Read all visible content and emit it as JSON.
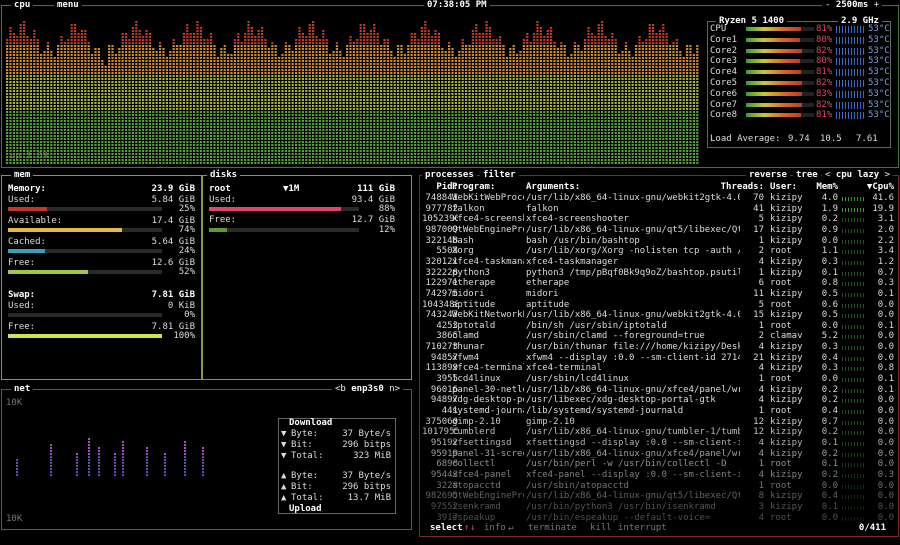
{
  "header": {
    "cpu_tab": "cpu",
    "menu_tab": "menu",
    "clock": "07:38:05 PM",
    "interval": "2500ms",
    "minus": "-",
    "plus": "+"
  },
  "cpu": {
    "model": "Ryzen 5 1400",
    "freq": "2.9 GHz",
    "uptime": "up 1:09",
    "cores": [
      {
        "name": "CPU",
        "pct": "81%",
        "pct_val": 81,
        "temp": "53°C"
      },
      {
        "name": "Core1",
        "pct": "80%",
        "pct_val": 80,
        "temp": "53°C"
      },
      {
        "name": "Core2",
        "pct": "82%",
        "pct_val": 82,
        "temp": "53°C"
      },
      {
        "name": "Core3",
        "pct": "80%",
        "pct_val": 80,
        "temp": "53°C"
      },
      {
        "name": "Core4",
        "pct": "81%",
        "pct_val": 81,
        "temp": "53°C"
      },
      {
        "name": "Core5",
        "pct": "82%",
        "pct_val": 82,
        "temp": "53°C"
      },
      {
        "name": "Core6",
        "pct": "83%",
        "pct_val": 83,
        "temp": "53°C"
      },
      {
        "name": "Core7",
        "pct": "82%",
        "pct_val": 82,
        "temp": "53°C"
      },
      {
        "name": "Core8",
        "pct": "81%",
        "pct_val": 81,
        "temp": "53°C"
      }
    ],
    "load_label": "Load Average:",
    "load": [
      "9.74",
      "10.5",
      "7.61"
    ]
  },
  "mem": {
    "tab": "mem",
    "memory_label": "Memory:",
    "memory_total": "23.9 GiB",
    "rows": [
      {
        "label": "Used:",
        "value": "5.84 GiB",
        "pct": "25%",
        "pct_val": 25,
        "color": "#c0392b"
      },
      {
        "label": "Available:",
        "value": "17.4 GiB",
        "pct": "74%",
        "pct_val": 74,
        "color": "#e5b94a"
      },
      {
        "label": "Cached:",
        "value": "5.64 GiB",
        "pct": "24%",
        "pct_val": 24,
        "color": "#3aa0b8"
      },
      {
        "label": "Free:",
        "value": "12.6 GiB",
        "pct": "52%",
        "pct_val": 52,
        "color": "#9bcc3a"
      }
    ],
    "swap_label": "Swap:",
    "swap_total": "7.81 GiB",
    "swap_rows": [
      {
        "label": "Used:",
        "value": "0 KiB",
        "pct": "0%",
        "pct_val": 0,
        "color": "#c0392b"
      },
      {
        "label": "Free:",
        "value": "7.81 GiB",
        "pct": "100%",
        "pct_val": 100,
        "color": "#c8e84a"
      }
    ]
  },
  "disks": {
    "tab": "disks",
    "root": "root",
    "io": "▼1M",
    "total": "111 GiB",
    "used_label": "Used:",
    "used": "93.4 GiB",
    "used_pct": "88%",
    "used_pct_val": 88,
    "used_color": "#e0456a",
    "free_label": "Free:",
    "free": "12.7 GiB",
    "free_pct": "12%",
    "free_pct_val": 12,
    "free_color": "#5a9a3a"
  },
  "net": {
    "tab": "net",
    "iface": "enp3s0",
    "prev": "<b",
    "next": "n>",
    "top_scale": "10K",
    "bottom_scale": "10K",
    "download_label": "Download",
    "upload_label": "Upload",
    "down": [
      {
        "arrow": "▼",
        "label": "Byte:",
        "value": "37 Byte/s"
      },
      {
        "arrow": "▼",
        "label": "Bit:",
        "value": "296 bitps"
      },
      {
        "arrow": "▼",
        "label": "Total:",
        "value": "323 MiB"
      }
    ],
    "up": [
      {
        "arrow": "▲",
        "label": "Byte:",
        "value": "37 Byte/s"
      },
      {
        "arrow": "▲",
        "label": "Bit:",
        "value": "296 bitps"
      },
      {
        "arrow": "▲",
        "label": "Total:",
        "value": "13.7 MiB"
      }
    ]
  },
  "proc": {
    "tabs": [
      "processes",
      "filter",
      "reverse",
      "tree",
      "cpu lazy"
    ],
    "lt": "<",
    "gt": ">",
    "headers": {
      "pid": "Pid:",
      "program": "Program:",
      "args": "Arguments:",
      "threads": "Threads:",
      "user": "User:",
      "mem": "Mem%",
      "cpu": "▼Cpu%"
    },
    "rows": [
      {
        "pid": "748841",
        "prog": "WebKitWebProce",
        "args": "/usr/lib/x86_64-linux-gnu/webkit2gtk-4.0/W",
        "thr": "70",
        "user": "kizipy",
        "mem": "4.0",
        "cpu": "41.6"
      },
      {
        "pid": "977782",
        "prog": "falkon",
        "args": "falkon",
        "thr": "41",
        "user": "kizipy",
        "mem": "1.9",
        "cpu": "19.9"
      },
      {
        "pid": "1052390",
        "prog": "xfce4-screensh",
        "args": "xfce4-screenshooter",
        "thr": "5",
        "user": "kizipy",
        "mem": "0.2",
        "cpu": "3.1"
      },
      {
        "pid": "987009",
        "prog": "QtWebEnginePro",
        "args": "/usr/lib/x86_64-linux-gnu/qt5/libexec/QtWe",
        "thr": "17",
        "user": "kizipy",
        "mem": "0.9",
        "cpu": "2.0"
      },
      {
        "pid": "322148",
        "prog": "bash",
        "args": "bash /usr/bin/bashtop",
        "thr": "1",
        "user": "kizipy",
        "mem": "0.0",
        "cpu": "2.2"
      },
      {
        "pid": "5508",
        "prog": "Xorg",
        "args": "/usr/lib/xorg/Xorg -nolisten tcp -auth /va",
        "thr": "2",
        "user": "root",
        "mem": "1.1",
        "cpu": "3.4"
      },
      {
        "pid": "320121",
        "prog": "xfce4-taskmana",
        "args": "xfce4-taskmanager",
        "thr": "4",
        "user": "kizipy",
        "mem": "0.3",
        "cpu": "1.2"
      },
      {
        "pid": "322228",
        "prog": "python3",
        "args": "python3 /tmp/pBqf0Bk9q9oZ/bashtop.psutil",
        "thr": "1",
        "user": "kizipy",
        "mem": "0.1",
        "cpu": "0.7"
      },
      {
        "pid": "122971",
        "prog": "etherape",
        "args": "etherape",
        "thr": "6",
        "user": "root",
        "mem": "0.8",
        "cpu": "0.3"
      },
      {
        "pid": "742975",
        "prog": "midori",
        "args": "midori",
        "thr": "11",
        "user": "kizipy",
        "mem": "0.5",
        "cpu": "0.1"
      },
      {
        "pid": "1043488",
        "prog": "aptitude",
        "args": "aptitude",
        "thr": "5",
        "user": "root",
        "mem": "0.6",
        "cpu": "0.0"
      },
      {
        "pid": "743247",
        "prog": "WebKitNetworkP",
        "args": "/usr/lib/x86_64-linux-gnu/webkit2gtk-4.0/W",
        "thr": "15",
        "user": "kizipy",
        "mem": "0.5",
        "cpu": "0.0"
      },
      {
        "pid": "4253",
        "prog": "iptotald",
        "args": "/bin/sh /usr/sbin/iptotald",
        "thr": "1",
        "user": "root",
        "mem": "0.0",
        "cpu": "0.1"
      },
      {
        "pid": "3865",
        "prog": "clamd",
        "args": "/usr/sbin/clamd --foreground=true",
        "thr": "2",
        "user": "clamav",
        "mem": "5.2",
        "cpu": "0.0"
      },
      {
        "pid": "710273",
        "prog": "thunar",
        "args": "/usr/bin/thunar file:///home/kizipy/Deskto",
        "thr": "4",
        "user": "kizipy",
        "mem": "0.3",
        "cpu": "0.0"
      },
      {
        "pid": "94857",
        "prog": "xfwm4",
        "args": "xfwm4 --display :0.0 --sm-client-id 271463",
        "thr": "21",
        "user": "kizipy",
        "mem": "0.4",
        "cpu": "0.0"
      },
      {
        "pid": "113899",
        "prog": "xfce4-terminal",
        "args": "xfce4-terminal",
        "thr": "4",
        "user": "kizipy",
        "mem": "0.3",
        "cpu": "0.8"
      },
      {
        "pid": "3955",
        "prog": "lcd4linux",
        "args": "/usr/sbin/lcd4linux",
        "thr": "1",
        "user": "root",
        "mem": "0.0",
        "cpu": "0.1"
      },
      {
        "pid": "96016",
        "prog": "panel-30-netlo",
        "args": "/usr/lib/x86_64-linux-gnu/xfce4/panel/wrap",
        "thr": "4",
        "user": "kizipy",
        "mem": "0.2",
        "cpu": "0.1"
      },
      {
        "pid": "94897",
        "prog": "xdg-desktop-po",
        "args": "/usr/libexec/xdg-desktop-portal-gtk",
        "thr": "4",
        "user": "kizipy",
        "mem": "0.2",
        "cpu": "0.0"
      },
      {
        "pid": "441",
        "prog": "systemd-journa",
        "args": "/lib/systemd/systemd-journald",
        "thr": "1",
        "user": "root",
        "mem": "0.4",
        "cpu": "0.0"
      },
      {
        "pid": "375060",
        "prog": "gimp-2.10",
        "args": "gimp-2.10",
        "thr": "12",
        "user": "kizipy",
        "mem": "0.7",
        "cpu": "0.0"
      },
      {
        "pid": "1017955",
        "prog": "tumblerd",
        "args": "/usr/lib/x86_64-linux-gnu/tumbler-1/tumble",
        "thr": "12",
        "user": "kizipy",
        "mem": "0.2",
        "cpu": "0.0"
      },
      {
        "pid": "95192",
        "prog": "xfsettingsd",
        "args": "xfsettingsd --display :0.0 --sm-client-id",
        "thr": "4",
        "user": "kizipy",
        "mem": "0.1",
        "cpu": "0.0"
      },
      {
        "pid": "95919",
        "prog": "panel-31-scree",
        "args": "/usr/lib/x86_64-linux-gnu/xfce4/panel/wrap",
        "thr": "4",
        "user": "kizipy",
        "mem": "0.2",
        "cpu": "0.0"
      },
      {
        "pid": "6898",
        "prog": "collectl",
        "args": "/usr/bin/perl -w /usr/bin/collectl -D",
        "thr": "1",
        "user": "root",
        "mem": "0.1",
        "cpu": "0.0"
      },
      {
        "pid": "95443",
        "prog": "xfce4-panel",
        "args": "xfce4-panel --display :0.0 --sm-client-id",
        "thr": "4",
        "user": "kizipy",
        "mem": "0.2",
        "cpu": "0.3"
      },
      {
        "pid": "3228",
        "prog": "atopacctd",
        "args": "/usr/sbin/atopacctd",
        "thr": "1",
        "user": "root",
        "mem": "0.0",
        "cpu": "0.0"
      },
      {
        "pid": "982695",
        "prog": "QtWebEnginePro",
        "args": "/usr/lib/x86_64-linux-gnu/qt5/libexec/QtWe",
        "thr": "8",
        "user": "kizipy",
        "mem": "0.4",
        "cpu": "0.0"
      },
      {
        "pid": "97552",
        "prog": "isenkramd",
        "args": "/usr/bin/python3 /usr/bin/isenkramd",
        "thr": "3",
        "user": "kizipy",
        "mem": "0.1",
        "cpu": "0.0"
      },
      {
        "pid": "3917",
        "prog": "espeakup",
        "args": "/usr/bin/espeakup --default-voice=",
        "thr": "4",
        "user": "root",
        "mem": "0.0",
        "cpu": "0.0"
      }
    ],
    "footer": {
      "select": "select",
      "up": "↑",
      "down": "↓",
      "info": "info",
      "enter": "↵",
      "terminate": "terminate",
      "kill": "kill",
      "interrupt": "interrupt",
      "count": "0/411"
    }
  },
  "colors": {
    "cpu_border": "#3a7a3a",
    "mem_border": "#8a9a3a",
    "net_border": "#5a4aa0",
    "proc_border": "#7a2a2a"
  }
}
